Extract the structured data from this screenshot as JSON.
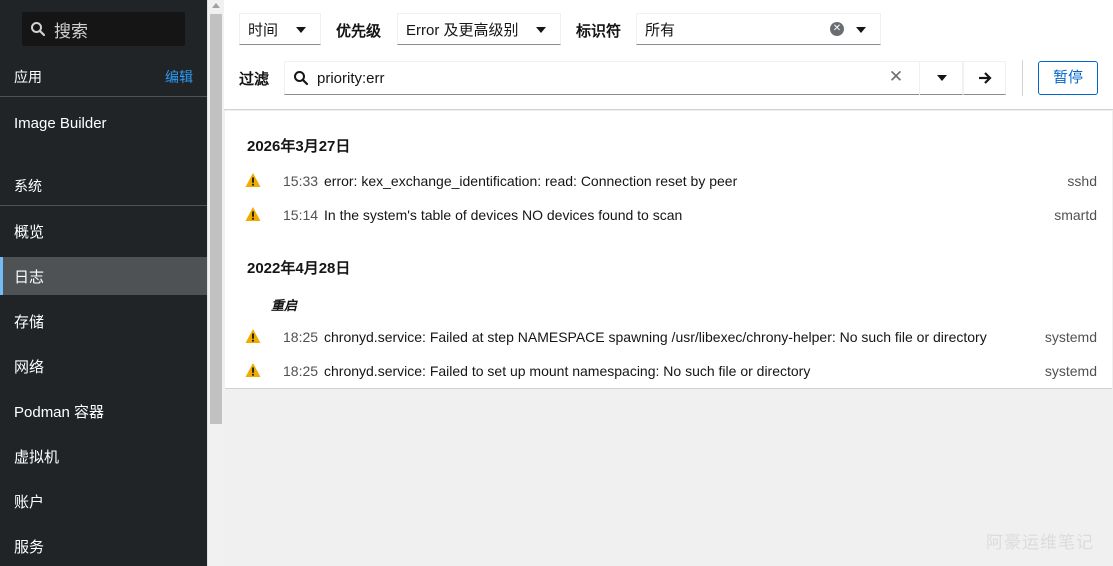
{
  "sidebar": {
    "search_placeholder": "搜索",
    "apps_header": "应用",
    "edit_label": "编辑",
    "app_items": [
      {
        "label": "Image Builder"
      }
    ],
    "system_header": "系统",
    "items": [
      {
        "label": "概览"
      },
      {
        "label": "日志",
        "active": true
      },
      {
        "label": "存储"
      },
      {
        "label": "网络"
      },
      {
        "label": "Podman 容器"
      },
      {
        "label": "虚拟机"
      },
      {
        "label": "账户"
      },
      {
        "label": "服务"
      }
    ]
  },
  "toolbar": {
    "time_select": "时间",
    "priority_label": "优先级",
    "priority_select": "Error 及更高级别",
    "identifier_label": "标识符",
    "identifier_select": "所有",
    "filter_label": "过滤",
    "filter_value": "priority:err",
    "pause_label": "暂停"
  },
  "logs": {
    "groups": [
      {
        "date": "2026年3月27日",
        "entries": [
          {
            "time": "15:33",
            "message": "error: kex_exchange_identification: read: Connection reset by peer",
            "identifier": "sshd"
          },
          {
            "time": "15:14",
            "message": "In the system's table of devices NO devices found to scan",
            "identifier": "smartd"
          }
        ]
      },
      {
        "date": "2022年4月28日",
        "reboot_label": "重启",
        "entries": [
          {
            "time": "18:25",
            "message": "chronyd.service: Failed at step NAMESPACE spawning /usr/libexec/chrony-helper: No such file or directory",
            "identifier": "systemd"
          },
          {
            "time": "18:25",
            "message": "chronyd.service: Failed to set up mount namespacing: No such file or directory",
            "identifier": "systemd"
          }
        ]
      }
    ]
  },
  "watermark": "阿豪运维笔记",
  "colors": {
    "warning": "#f0ab00",
    "accent": "#0066cc",
    "sidebar_bg": "#212427",
    "active_bar": "#73bcf7"
  }
}
